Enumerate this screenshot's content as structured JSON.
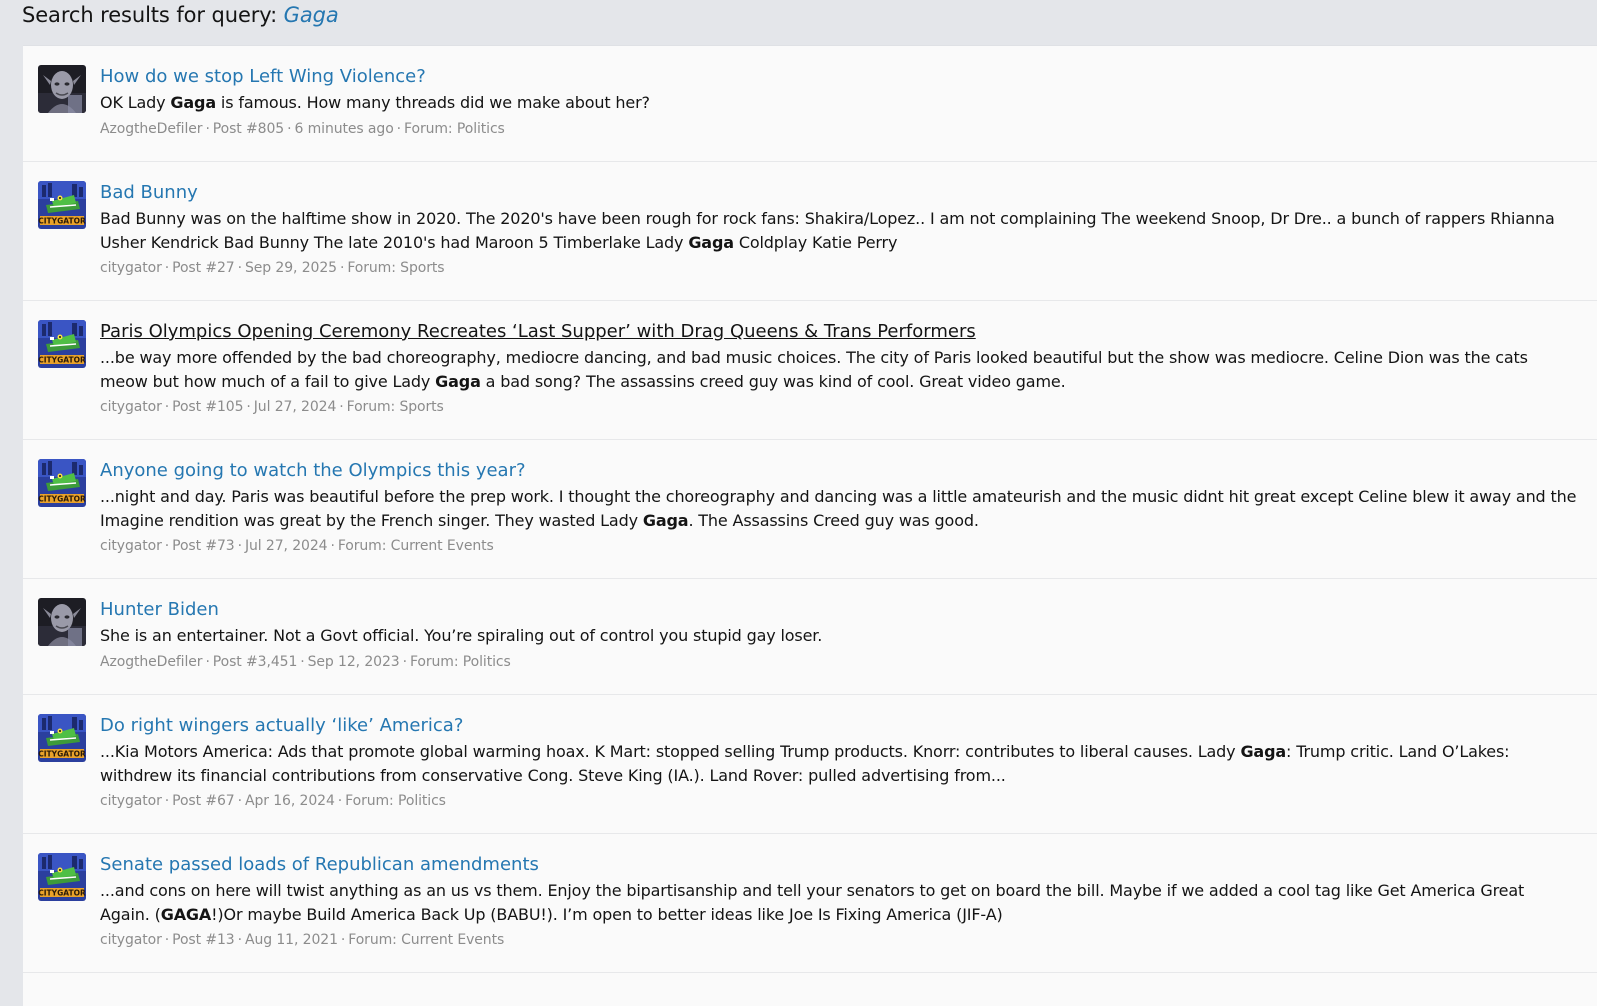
{
  "header": {
    "prefix": "Search results for query: ",
    "query": "Gaga"
  },
  "results": [
    {
      "avatar": "orc-avatar",
      "title": "How do we stop Left Wing Violence?",
      "snippet_pre": "OK Lady ",
      "snippet_match": "Gaga",
      "snippet_post": " is famous. How many threads did we make about her?",
      "snippet_pre2": "",
      "snippet_match2": "",
      "snippet_post2": "",
      "author": "AzogtheDefiler",
      "post": "Post #805",
      "date": "6 minutes ago",
      "forum": "Forum: Politics"
    },
    {
      "avatar": "citygator-avatar",
      "title": "Bad Bunny",
      "snippet_pre": "Bad Bunny was on the halftime show in 2020. The 2020's have been rough for rock fans: Shakira/Lopez.. I am not complaining The weekend Snoop, Dr Dre.. a bunch of rappers Rhianna Usher Kendrick Bad Bunny The late 2010's had Maroon 5 Timberlake Lady ",
      "snippet_match": "Gaga",
      "snippet_post": " Coldplay Katie Perry",
      "snippet_pre2": "",
      "snippet_match2": "",
      "snippet_post2": "",
      "author": "citygator",
      "post": "Post #27",
      "date": "Sep 29, 2025",
      "forum": "Forum: Sports"
    },
    {
      "avatar": "citygator-avatar",
      "title": "Paris Olympics Opening Ceremony Recreates ‘Last Supper’ with Drag Queens & Trans Performers",
      "snippet_pre": "...be way more offended by the bad choreography, mediocre dancing, and bad music choices. The city of Paris looked beautiful but the show was mediocre. Celine Dion was the cats meow but how much of a fail to give Lady ",
      "snippet_match": "Gaga",
      "snippet_post": " a bad song? The assassins creed guy was kind of cool. Great video game.",
      "snippet_pre2": "",
      "snippet_match2": "",
      "snippet_post2": "",
      "author": "citygator",
      "post": "Post #105",
      "date": "Jul 27, 2024",
      "forum": "Forum: Sports"
    },
    {
      "avatar": "citygator-avatar",
      "title": "Anyone going to watch the Olympics this year?",
      "snippet_pre": "...night and day. Paris was beautiful before the prep work. I thought the choreography and dancing was a little amateurish and the music didnt hit great except Celine blew it away and the Imagine rendition was great by the French singer. They wasted Lady ",
      "snippet_match": "Gaga",
      "snippet_post": ". The Assassins Creed guy was good.",
      "snippet_pre2": "",
      "snippet_match2": "",
      "snippet_post2": "",
      "author": "citygator",
      "post": "Post #73",
      "date": "Jul 27, 2024",
      "forum": "Forum: Current Events"
    },
    {
      "avatar": "orc-avatar",
      "title": "Hunter Biden",
      "snippet_pre": "She is an entertainer. Not a Govt official. You’re spiraling out of control you stupid gay loser.",
      "snippet_match": "",
      "snippet_post": "",
      "snippet_pre2": "",
      "snippet_match2": "",
      "snippet_post2": "",
      "author": "AzogtheDefiler",
      "post": "Post #3,451",
      "date": "Sep 12, 2023",
      "forum": "Forum: Politics"
    },
    {
      "avatar": "citygator-avatar",
      "title": "Do right wingers actually ‘like’ America?",
      "snippet_pre": "...Kia Motors America: Ads that promote global warming hoax. K Mart: stopped selling Trump products. Knorr: contributes to liberal causes. Lady ",
      "snippet_match": "Gaga",
      "snippet_post": ": Trump critic. Land O’Lakes: withdrew its financial contributions from conservative Cong. Steve King (IA.). Land Rover: pulled advertising from...",
      "snippet_pre2": "",
      "snippet_match2": "",
      "snippet_post2": "",
      "author": "citygator",
      "post": "Post #67",
      "date": "Apr 16, 2024",
      "forum": "Forum: Politics"
    },
    {
      "avatar": "citygator-avatar",
      "title": "Senate passed loads of Republican amendments",
      "snippet_pre": "...and cons on here will twist anything as an us vs them. Enjoy the bipartisanship and tell your senators to get on board the bill. Maybe if we added a cool tag like Get America Great Again. (",
      "snippet_match": "GAGA",
      "snippet_post": "!)Or maybe Build America Back Up (BABU!). I’m open to better ideas like Joe Is Fixing America (JIF-A)",
      "snippet_pre2": "",
      "snippet_match2": "",
      "snippet_post2": "",
      "author": "citygator",
      "post": "Post #13",
      "date": "Aug 11, 2021",
      "forum": "Forum: Current Events"
    }
  ],
  "separator": "·"
}
